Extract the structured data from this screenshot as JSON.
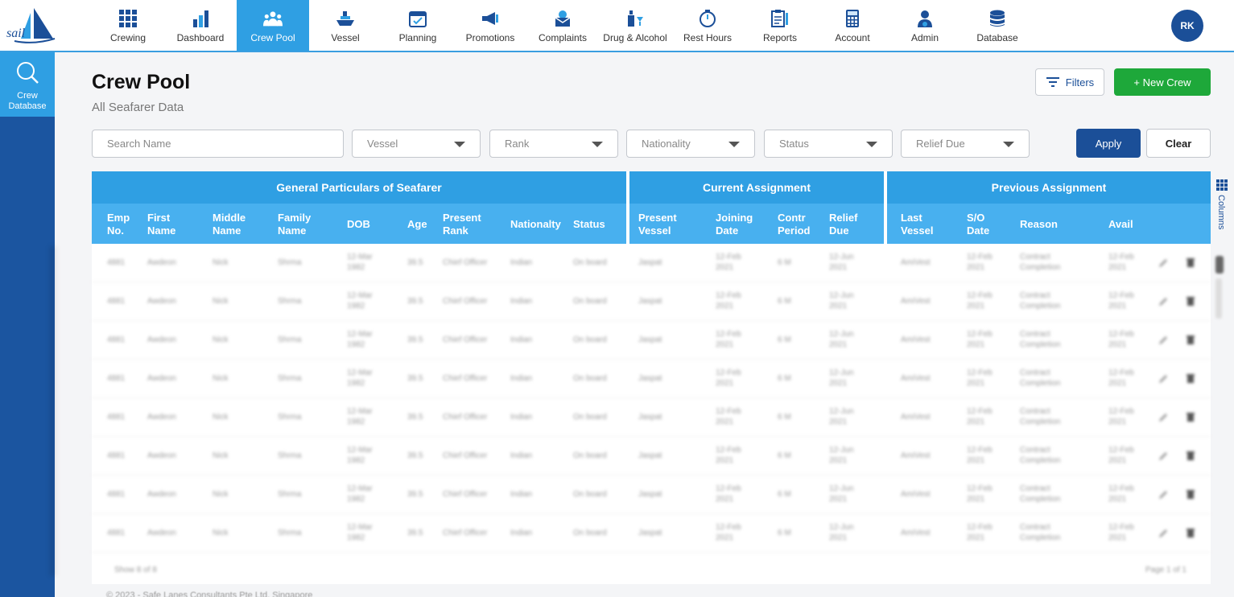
{
  "brand": {
    "logo_text": "sail"
  },
  "nav": {
    "items": [
      {
        "label": "Crewing",
        "icon": "grid-icon"
      },
      {
        "label": "Dashboard",
        "icon": "bar-chart-icon"
      },
      {
        "label": "Crew Pool",
        "icon": "people-icon",
        "active": true
      },
      {
        "label": "Vessel",
        "icon": "ship-icon"
      },
      {
        "label": "Planning",
        "icon": "calendar-icon"
      },
      {
        "label": "Promotions",
        "icon": "megaphone-icon"
      },
      {
        "label": "Complaints",
        "icon": "complaint-icon"
      },
      {
        "label": "Drug & Alcohol",
        "icon": "bottle-icon"
      },
      {
        "label": "Rest Hours",
        "icon": "stopwatch-icon"
      },
      {
        "label": "Reports",
        "icon": "report-icon"
      },
      {
        "label": "Account",
        "icon": "calculator-icon"
      },
      {
        "label": "Admin",
        "icon": "admin-icon"
      },
      {
        "label": "Database",
        "icon": "database-icon"
      }
    ],
    "avatar_initials": "RK"
  },
  "sidebar": {
    "items": [
      {
        "label": "Crew Database",
        "icon": "search-icon"
      }
    ]
  },
  "page": {
    "title": "Crew Pool",
    "subtitle": "All Seafarer Data",
    "filters_label": "Filters",
    "new_crew_label": "+ New Crew"
  },
  "filters": {
    "search_placeholder": "Search Name",
    "vessel": "Vessel",
    "rank": "Rank",
    "nationality": "Nationality",
    "status": "Status",
    "relief_due": "Relief Due",
    "apply_label": "Apply",
    "clear_label": "Clear"
  },
  "table": {
    "groups": [
      "General Particulars of Seafarer",
      "Current  Assignment",
      "Previous  Assignment"
    ],
    "columns": [
      [
        "Emp",
        "No."
      ],
      [
        "First",
        "Name"
      ],
      [
        "Middle",
        "Name"
      ],
      [
        "Family",
        "Name"
      ],
      [
        "DOB",
        ""
      ],
      [
        "Age",
        ""
      ],
      [
        "Present",
        "Rank"
      ],
      [
        "Nationalty",
        ""
      ],
      [
        "Status",
        ""
      ],
      [
        "Present",
        "Vessel"
      ],
      [
        "Joining",
        "Date"
      ],
      [
        "Contr",
        "Period"
      ],
      [
        "Relief",
        "Due"
      ],
      [
        "Last",
        "Vessel"
      ],
      [
        "S/O",
        "Date"
      ],
      [
        "Reason",
        ""
      ],
      [
        "Avail",
        ""
      ]
    ],
    "rows": [
      [
        "4881",
        "Awdeon",
        "Nick",
        "Shrma",
        [
          "12-Mar",
          "1982"
        ],
        "39.5",
        "Chief Officer",
        "Indian",
        "On board",
        "Jaspat",
        [
          "12-Feb",
          "2021"
        ],
        "6 M",
        [
          "12-Jun",
          "2021"
        ],
        "AmiVest",
        [
          "12-Feb",
          "2021"
        ],
        [
          "Contract",
          "Completion"
        ],
        [
          "12-Feb",
          "2021"
        ]
      ],
      [
        "4881",
        "Awdeon",
        "Nick",
        "Shrma",
        [
          "12-Mar",
          "1982"
        ],
        "39.5",
        "Chief Officer",
        "Indian",
        "On board",
        "Jaspat",
        [
          "12-Feb",
          "2021"
        ],
        "6 M",
        [
          "12-Jun",
          "2021"
        ],
        "AmiVest",
        [
          "12-Feb",
          "2021"
        ],
        [
          "Contract",
          "Completion"
        ],
        [
          "12-Feb",
          "2021"
        ]
      ],
      [
        "4881",
        "Awdeon",
        "Nick",
        "Shrma",
        [
          "12-Mar",
          "1982"
        ],
        "39.5",
        "Chief Officer",
        "Indian",
        "On board",
        "Jaspat",
        [
          "12-Feb",
          "2021"
        ],
        "6 M",
        [
          "12-Jun",
          "2021"
        ],
        "AmiVest",
        [
          "12-Feb",
          "2021"
        ],
        [
          "Contract",
          "Completion"
        ],
        [
          "12-Feb",
          "2021"
        ]
      ],
      [
        "4881",
        "Awdeon",
        "Nick",
        "Shrma",
        [
          "12-Mar",
          "1982"
        ],
        "39.5",
        "Chief Officer",
        "Indian",
        "On board",
        "Jaspat",
        [
          "12-Feb",
          "2021"
        ],
        "6 M",
        [
          "12-Jun",
          "2021"
        ],
        "AmiVest",
        [
          "12-Feb",
          "2021"
        ],
        [
          "Contract",
          "Completion"
        ],
        [
          "12-Feb",
          "2021"
        ]
      ],
      [
        "4881",
        "Awdeon",
        "Nick",
        "Shrma",
        [
          "12-Mar",
          "1982"
        ],
        "39.5",
        "Chief Officer",
        "Indian",
        "On board",
        "Jaspat",
        [
          "12-Feb",
          "2021"
        ],
        "6 M",
        [
          "12-Jun",
          "2021"
        ],
        "AmiVest",
        [
          "12-Feb",
          "2021"
        ],
        [
          "Contract",
          "Completion"
        ],
        [
          "12-Feb",
          "2021"
        ]
      ],
      [
        "4881",
        "Awdeon",
        "Nick",
        "Shrma",
        [
          "12-Mar",
          "1982"
        ],
        "39.5",
        "Chief Officer",
        "Indian",
        "On board",
        "Jaspat",
        [
          "12-Feb",
          "2021"
        ],
        "6 M",
        [
          "12-Jun",
          "2021"
        ],
        "AmiVest",
        [
          "12-Feb",
          "2021"
        ],
        [
          "Contract",
          "Completion"
        ],
        [
          "12-Feb",
          "2021"
        ]
      ],
      [
        "4881",
        "Awdeon",
        "Nick",
        "Shrma",
        [
          "12-Mar",
          "1982"
        ],
        "39.5",
        "Chief Officer",
        "Indian",
        "On board",
        "Jaspat",
        [
          "12-Feb",
          "2021"
        ],
        "6 M",
        [
          "12-Jun",
          "2021"
        ],
        "AmiVest",
        [
          "12-Feb",
          "2021"
        ],
        [
          "Contract",
          "Completion"
        ],
        [
          "12-Feb",
          "2021"
        ]
      ],
      [
        "4881",
        "Awdeon",
        "Nick",
        "Shrma",
        [
          "12-Mar",
          "1982"
        ],
        "39.5",
        "Chief Officer",
        "Indian",
        "On board",
        "Jaspat",
        [
          "12-Feb",
          "2021"
        ],
        "6 M",
        [
          "12-Jun",
          "2021"
        ],
        "AmiVest",
        [
          "12-Feb",
          "2021"
        ],
        [
          "Contract",
          "Completion"
        ],
        [
          "12-Feb",
          "2021"
        ]
      ]
    ],
    "columns_label": "Columns",
    "footer_left": "Show 8 of 8",
    "footer_right": "Page 1 of 1"
  },
  "copyright": "© 2023 - Safe Lanes Consultants Pte Ltd, Singapore",
  "colors": {
    "primary": "#1b4f98",
    "accent": "#2f9fe3",
    "success": "#1ea83a"
  }
}
